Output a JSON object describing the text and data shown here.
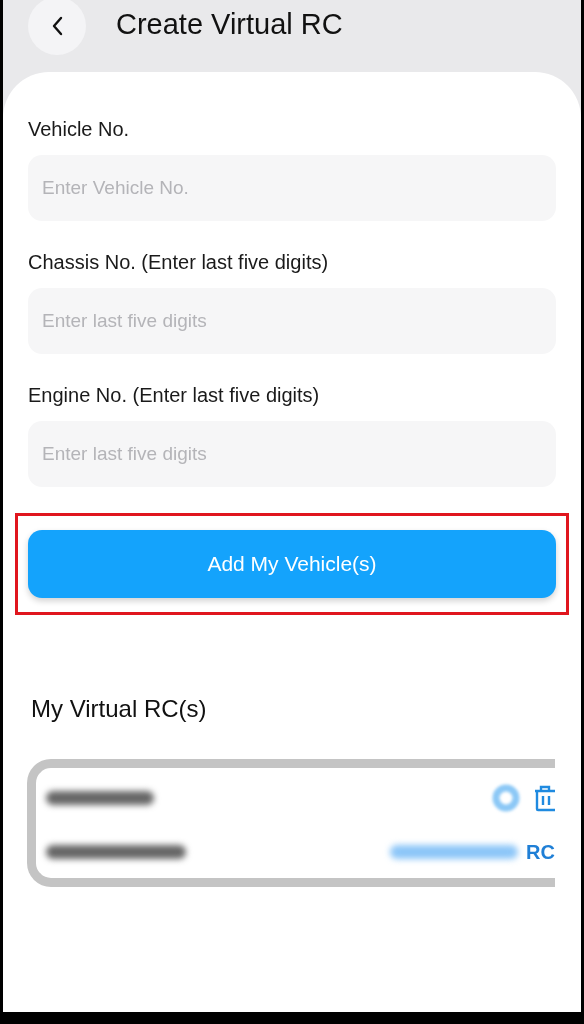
{
  "header": {
    "title": "Create Virtual RC"
  },
  "fields": [
    {
      "label": "Vehicle No.",
      "placeholder": "Enter Vehicle No."
    },
    {
      "label": "Chassis No. (Enter last five digits)",
      "placeholder": "Enter last five digits"
    },
    {
      "label": "Engine No. (Enter last five digits)",
      "placeholder": "Enter last five digits"
    }
  ],
  "submit_button": {
    "label": "Add My Vehicle(s)",
    "highlighted": true
  },
  "section_title": "My Virtual RC(s)",
  "rc_card": {
    "link_visible_part": "RC"
  }
}
